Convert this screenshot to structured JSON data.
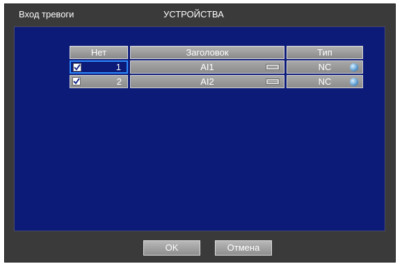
{
  "window": {
    "left_title": "Вход тревоги",
    "center_title": "УСТРОЙСТВА"
  },
  "table": {
    "columns": [
      "Нет",
      "Заголовок",
      "Тип"
    ],
    "rows": [
      {
        "checked": true,
        "number": "1",
        "title": "AI1",
        "type": "NC",
        "selected": true
      },
      {
        "checked": true,
        "number": "2",
        "title": "AI2",
        "type": "NC",
        "selected": false
      }
    ]
  },
  "footer": {
    "ok_label": "OK",
    "cancel_label": "Отмена"
  }
}
